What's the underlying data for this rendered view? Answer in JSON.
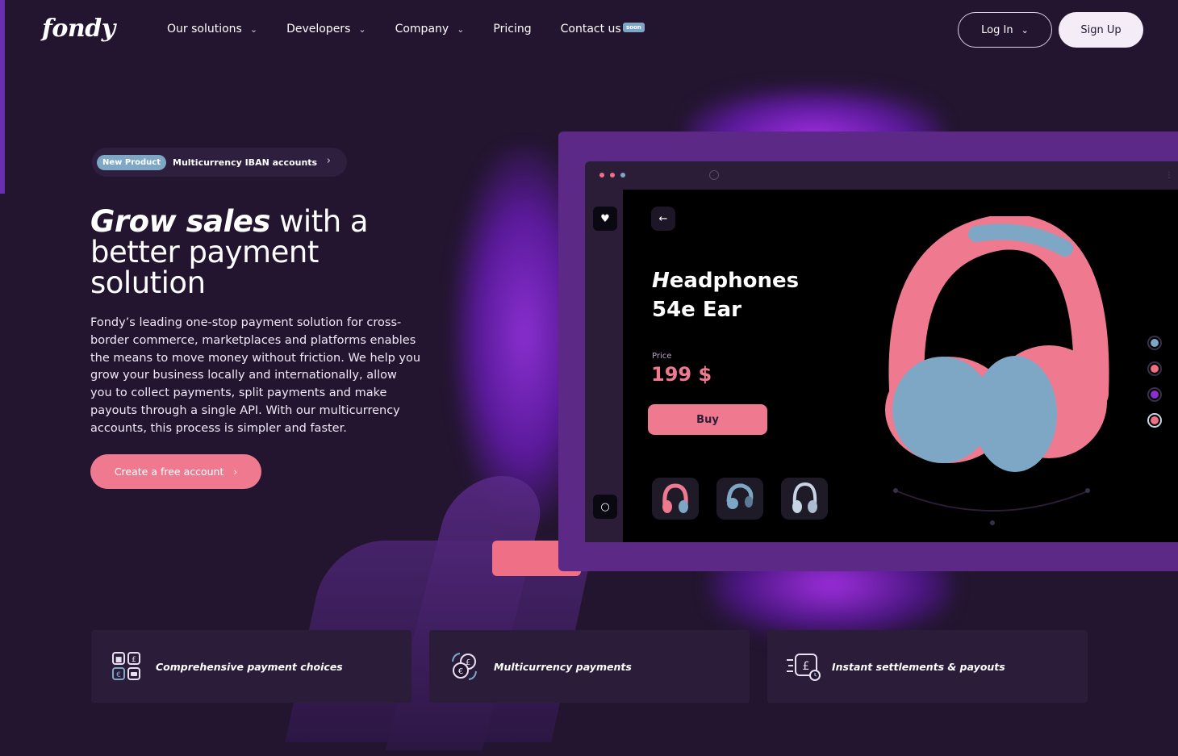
{
  "header": {
    "logo": "fondy",
    "nav": [
      {
        "label": "Our solutions",
        "has_dropdown": true
      },
      {
        "label": "Developers",
        "has_dropdown": true
      },
      {
        "label": "Company",
        "has_dropdown": true
      },
      {
        "label": "Pricing",
        "has_dropdown": false
      },
      {
        "label": "Contact us",
        "has_dropdown": false
      }
    ],
    "contact_badge": "soon",
    "login_label": "Log In",
    "signup_label": "Sign Up"
  },
  "hero": {
    "pill_badge": "New Product",
    "pill_text": "Multicurrency IBAN accounts",
    "title_em": "Grow sales",
    "title_rest": " with a better payment solution",
    "description": "Fondy’s leading one-stop payment solution for cross-border commerce, marketplaces and platforms enables the means to move money without friction. We help you grow your business locally and internationally, allow you to collect payments, split payments and make payouts through a single API. With our multicurrency accounts, this process is simpler and faster.",
    "cta_label": "Create a free account"
  },
  "product_demo": {
    "name_line1_em": "H",
    "name_line1_rest": "eadphones",
    "name_line2": "54e Ear",
    "price_label": "Price",
    "price": "199 $",
    "buy_label": "Buy",
    "color_options": [
      "#7ea7c6",
      "#ef6f86",
      "#8a2fd0",
      "#ef6f86"
    ],
    "colors": {
      "pink": "#ef7a90",
      "blue": "#7ea7c6",
      "purple": "#8a2fd0"
    }
  },
  "features": [
    {
      "label": "Comprehensive payment choices",
      "icon": "payment-methods-icon"
    },
    {
      "label": "Multicurrency payments",
      "icon": "currency-exchange-icon"
    },
    {
      "label": "Instant settlements & payouts",
      "icon": "fast-payout-icon"
    }
  ]
}
